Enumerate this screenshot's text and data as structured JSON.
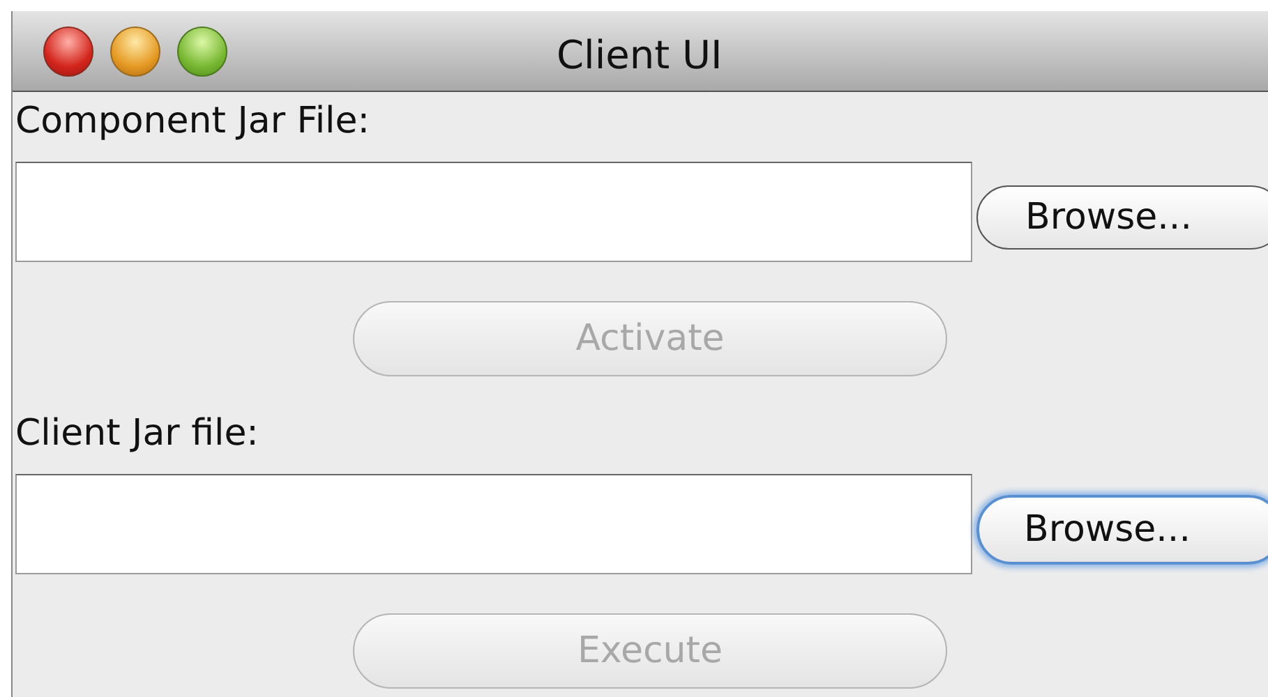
{
  "window": {
    "title": "Client UI"
  },
  "sections": [
    {
      "label": "Component Jar File:",
      "browse": {
        "label": "Browse...",
        "focused": false
      },
      "action": {
        "label": "Activate",
        "disabled": true
      }
    },
    {
      "label": "Client Jar file:",
      "browse": {
        "label": "Browse...",
        "focused": true
      },
      "action": {
        "label": "Execute",
        "disabled": true
      }
    }
  ]
}
